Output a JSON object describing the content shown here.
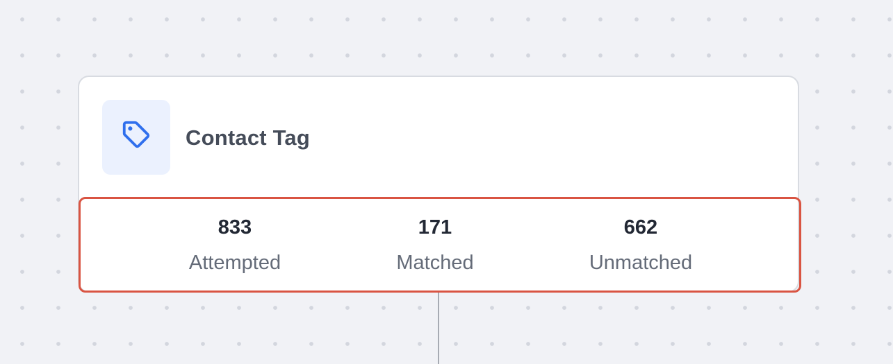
{
  "node": {
    "title": "Contact Tag",
    "icon": "tag-icon",
    "accent_color": "#2f6fed",
    "icon_tile_color": "#ebf1fe"
  },
  "stats": {
    "attempted": {
      "value": "833",
      "label": "Attempted"
    },
    "matched": {
      "value": "171",
      "label": "Matched"
    },
    "unmatched": {
      "value": "662",
      "label": "Unmatched"
    }
  },
  "highlight_color": "#d95442"
}
